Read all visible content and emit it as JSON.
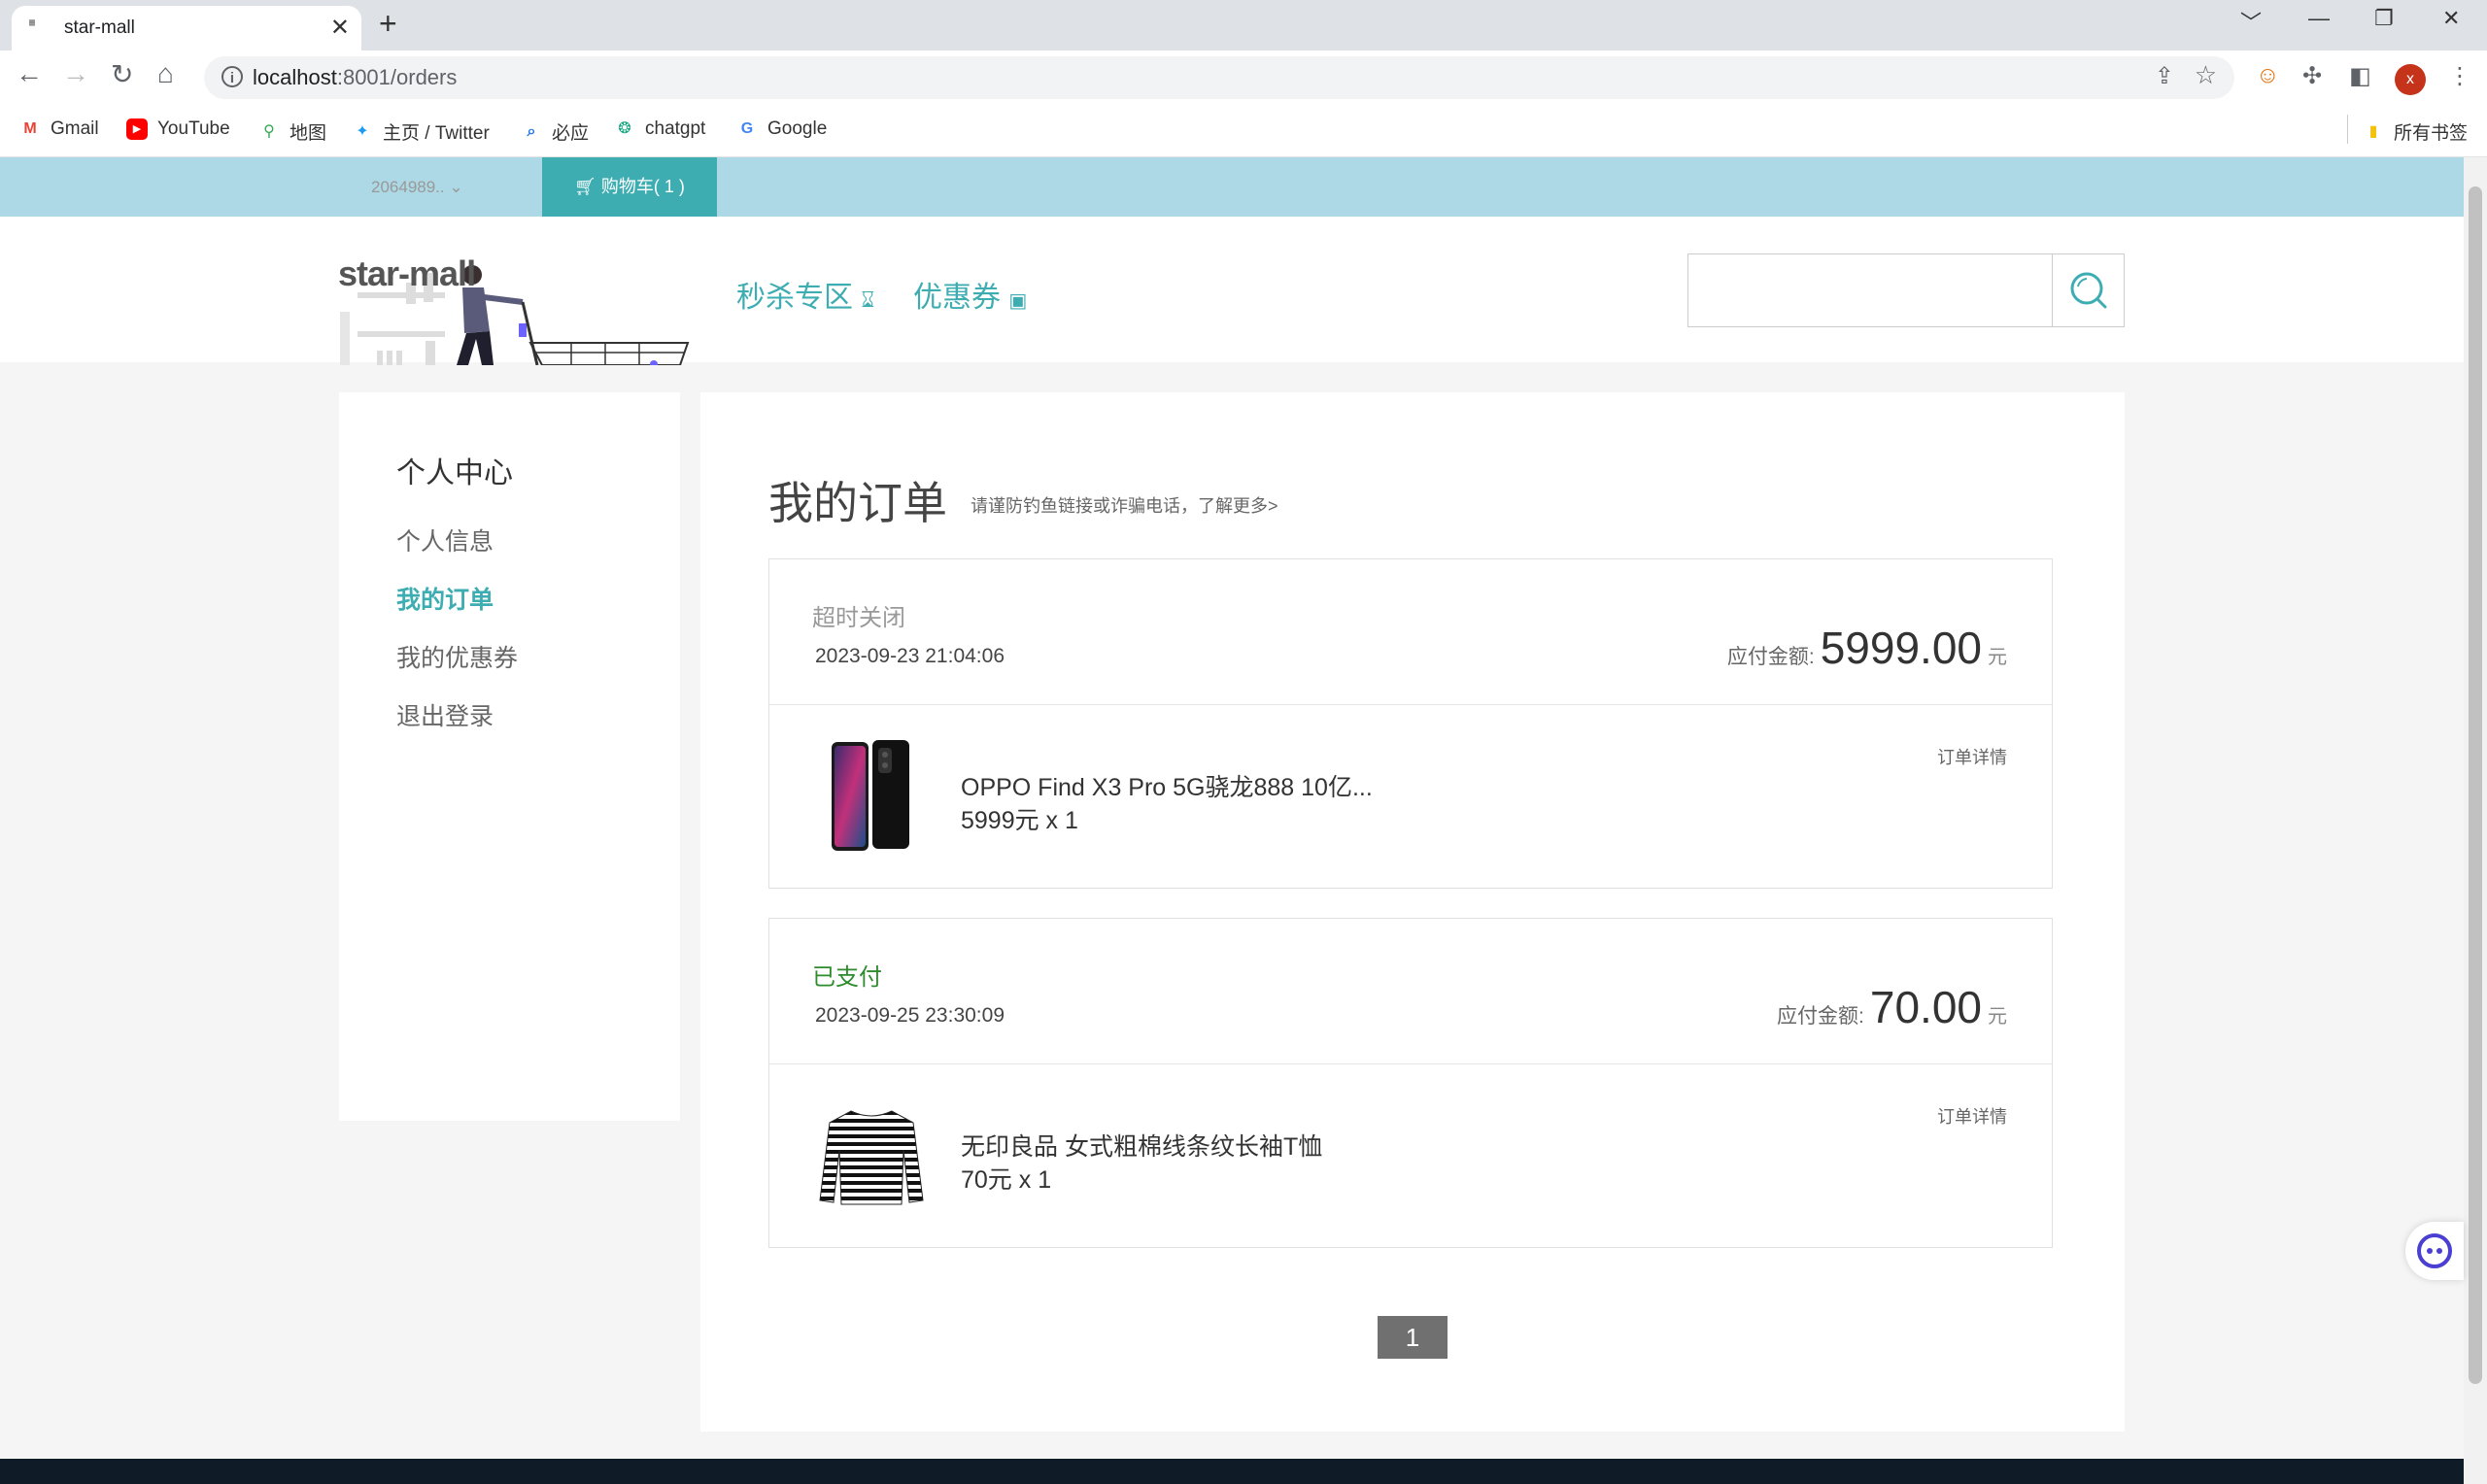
{
  "browser": {
    "tab_title": "star-mall",
    "tab_favicon_text": "New\nnew",
    "new_tab": "+",
    "url_host": "localhost",
    "url_rest": ":8001/orders",
    "profile_initial": "x",
    "window_controls": [
      "﹀",
      "—",
      "❐",
      "✕"
    ]
  },
  "bookmarks": {
    "items": [
      {
        "label": "Gmail",
        "icon": "gmail-icon",
        "color": "#ea4335"
      },
      {
        "label": "YouTube",
        "icon": "youtube-icon",
        "color": "#ff0000"
      },
      {
        "label": "地图",
        "icon": "maps-icon",
        "color": "#34a853"
      },
      {
        "label": "主页 / Twitter",
        "icon": "twitter-icon",
        "color": "#1d9bf0"
      },
      {
        "label": "必应",
        "icon": "search-icon",
        "color": "#1a73e8"
      },
      {
        "label": "chatgpt",
        "icon": "chatgpt-icon",
        "color": "#10a37f"
      },
      {
        "label": "Google",
        "icon": "google-icon",
        "color": "#4285f4"
      }
    ],
    "all_bookmarks": "所有书签"
  },
  "topbar": {
    "user": "2064989..",
    "cart": "购物车( 1 )"
  },
  "header": {
    "brand": "star-mall",
    "nav": [
      {
        "label": "秒杀专区",
        "icon": "flash-sale-icon"
      },
      {
        "label": "优惠券",
        "icon": "coupon-icon"
      }
    ],
    "search_placeholder": ""
  },
  "sidebar": {
    "title": "个人中心",
    "items": [
      {
        "label": "个人信息",
        "active": false
      },
      {
        "label": "我的订单",
        "active": true
      },
      {
        "label": "我的优惠券",
        "active": false
      },
      {
        "label": "退出登录",
        "active": false
      }
    ]
  },
  "main": {
    "title": "我的订单",
    "tip": "请谨防钓鱼链接或诈骗电话，了解更多>",
    "orders": [
      {
        "status": "超时关闭",
        "status_color": "#999999",
        "time": "2023-09-23 21:04:06",
        "amount_label": "应付金额:",
        "amount": "5999.00",
        "unit": "元",
        "product_name": "OPPO Find X3 Pro 5G骁龙888 10亿...",
        "product_price": "5999元 x 1",
        "detail_link": "订单详情",
        "image": "phone"
      },
      {
        "status": "已支付",
        "status_color": "#2e8b2e",
        "time": "2023-09-25 23:30:09",
        "amount_label": "应付金额:",
        "amount": "70.00",
        "unit": "元",
        "product_name": "无印良品 女式粗棉线条纹长袖T恤",
        "product_price": "70元 x 1",
        "detail_link": "订单详情",
        "image": "shirt"
      }
    ],
    "pagination": {
      "current": "1"
    }
  },
  "colors": {
    "accent": "#3eadb2",
    "topbar": "#acd9e5",
    "footer": "#0f1b26"
  }
}
